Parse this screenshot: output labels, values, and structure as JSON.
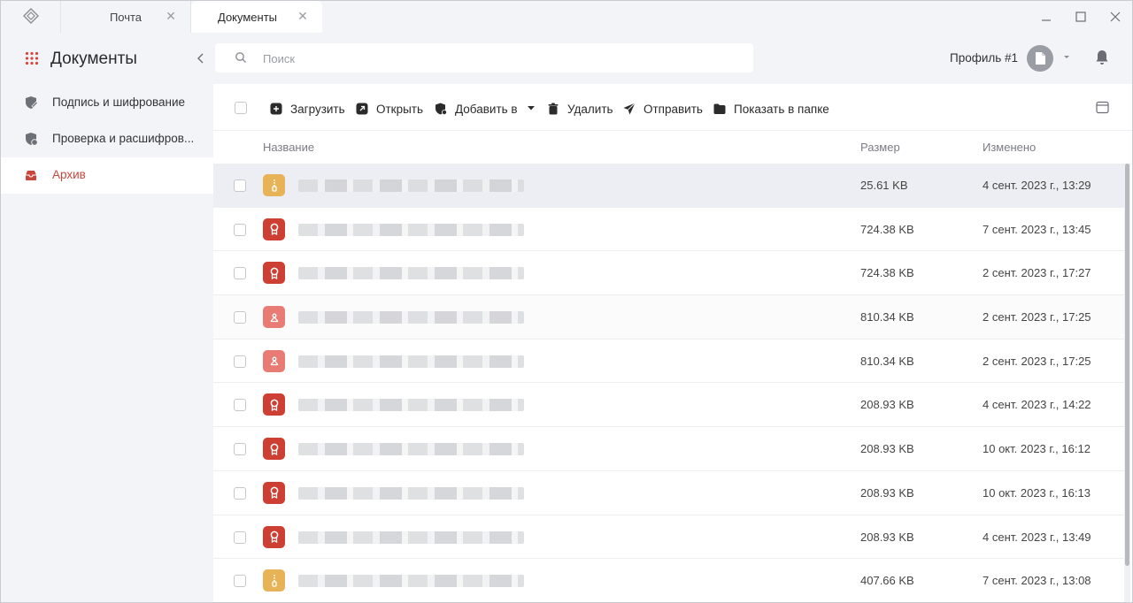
{
  "tabs": [
    {
      "label": "Почта",
      "active": false
    },
    {
      "label": "Документы",
      "active": true
    }
  ],
  "sidebar": {
    "title": "Документы",
    "items": [
      {
        "label": "Подпись и шифрование",
        "icon": "shield-pen-icon",
        "active": false
      },
      {
        "label": "Проверка и расшифров...",
        "icon": "shield-check-icon",
        "active": false
      },
      {
        "label": "Архив",
        "icon": "archive-icon",
        "active": true
      }
    ]
  },
  "search": {
    "placeholder": "Поиск",
    "value": ""
  },
  "profile": {
    "name": "Профиль #1"
  },
  "toolbar": {
    "upload": "Загрузить",
    "open": "Открыть",
    "add_to": "Добавить в",
    "delete": "Удалить",
    "send": "Отправить",
    "show_in_folder": "Показать в папке"
  },
  "table": {
    "headers": {
      "name": "Название",
      "size": "Размер",
      "modified": "Изменено"
    },
    "rows": [
      {
        "type": "zip",
        "size": "25.61 KB",
        "modified": "4 сент. 2023 г., 13:29"
      },
      {
        "type": "sig",
        "size": "724.38 KB",
        "modified": "7 сент. 2023 г., 13:45"
      },
      {
        "type": "sig",
        "size": "724.38 KB",
        "modified": "2 сент. 2023 г., 17:27"
      },
      {
        "type": "pdf",
        "size": "810.34 KB",
        "modified": "2 сент. 2023 г., 17:25"
      },
      {
        "type": "pdf",
        "size": "810.34 KB",
        "modified": "2 сент. 2023 г., 17:25"
      },
      {
        "type": "sig",
        "size": "208.93 KB",
        "modified": "4 сент. 2023 г., 14:22"
      },
      {
        "type": "sig",
        "size": "208.93 KB",
        "modified": "10 окт. 2023 г., 16:12"
      },
      {
        "type": "sig",
        "size": "208.93 KB",
        "modified": "10 окт. 2023 г., 16:13"
      },
      {
        "type": "sig",
        "size": "208.93 KB",
        "modified": "4 сент. 2023 г., 13:49"
      },
      {
        "type": "zip",
        "size": "407.66 KB",
        "modified": "7 сент. 2023 г., 13:08"
      }
    ]
  },
  "colors": {
    "accent": "#c8463b",
    "zip": "#e8b257",
    "sig": "#cd3f33",
    "pdf": "#e87c75"
  }
}
